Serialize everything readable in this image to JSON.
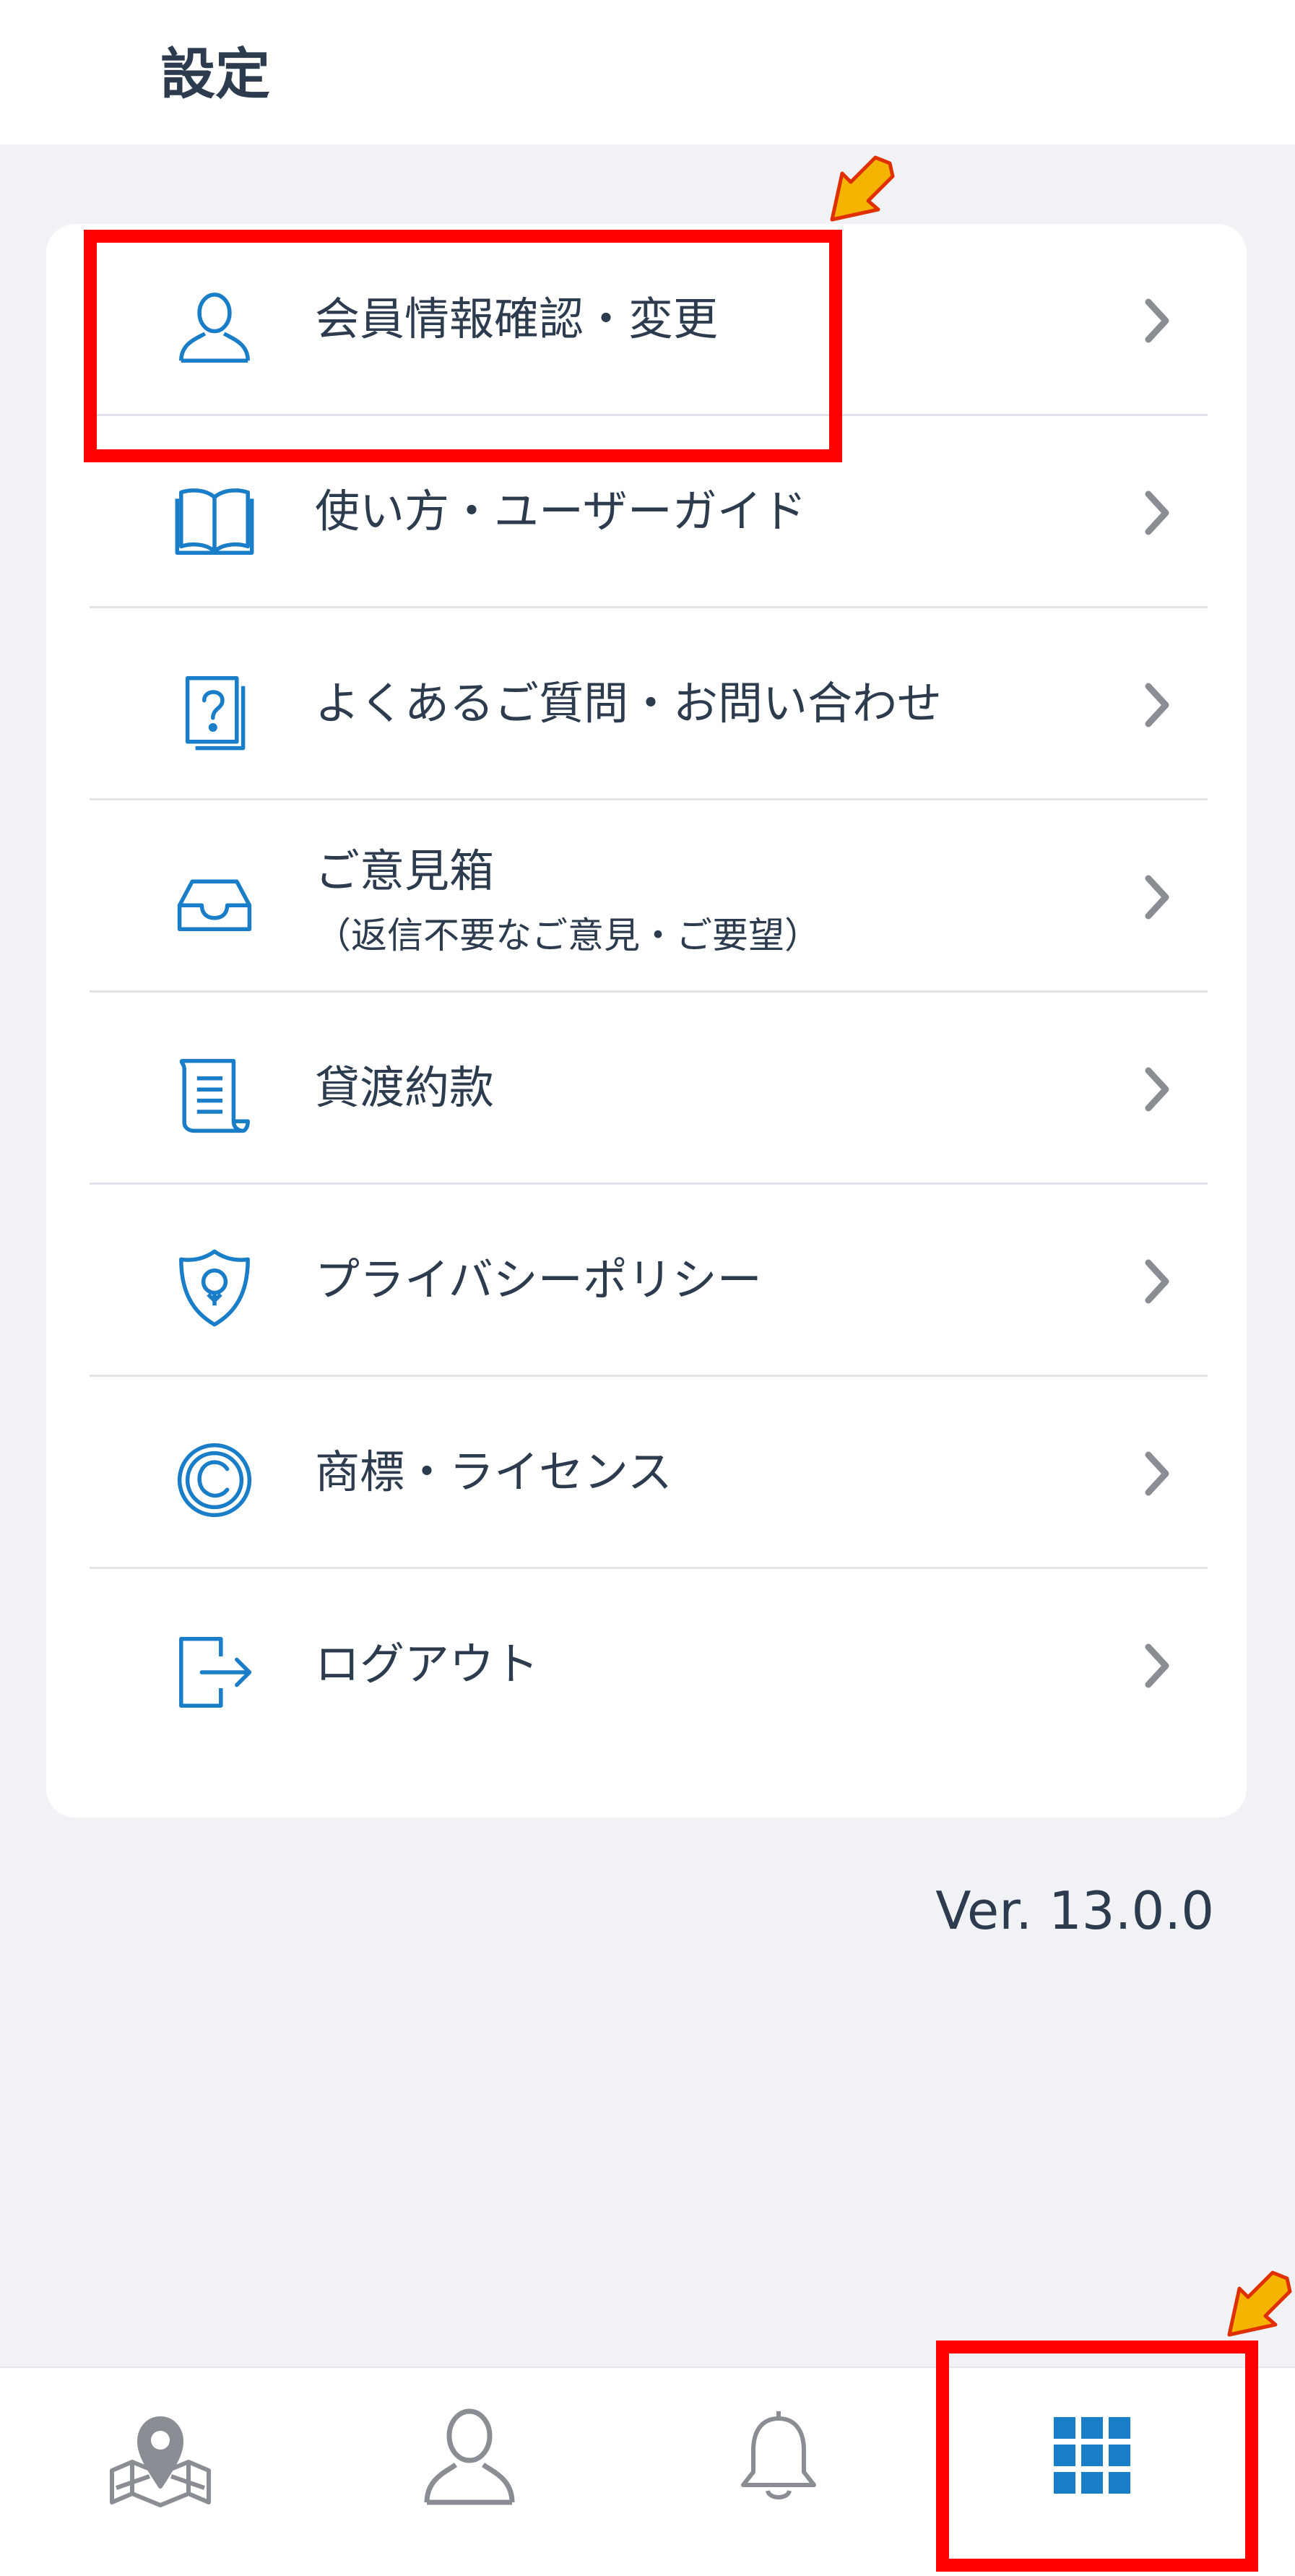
{
  "header": {
    "title": "設定"
  },
  "menu": {
    "items": [
      {
        "label": "会員情報確認・変更",
        "icon": "user-icon"
      },
      {
        "label": "使い方・ユーザーガイド",
        "icon": "book-icon"
      },
      {
        "label": "よくあるご質問・お問い合わせ",
        "icon": "faq-icon"
      },
      {
        "label": "ご意見箱",
        "sublabel": "（返信不要なご意見・ご要望）",
        "icon": "inbox-tray-icon"
      },
      {
        "label": "貸渡約款",
        "icon": "scroll-document-icon"
      },
      {
        "label": "プライバシーポリシー",
        "icon": "shield-icon"
      },
      {
        "label": "商標・ライセンス",
        "icon": "copyright-icon"
      },
      {
        "label": "ログアウト",
        "icon": "logout-icon"
      }
    ]
  },
  "version": "Ver. 13.0.0",
  "tabbar": {
    "tabs": [
      {
        "icon": "map-pin-icon"
      },
      {
        "icon": "user-icon"
      },
      {
        "icon": "bell-icon"
      },
      {
        "icon": "grid-menu-icon",
        "active": true
      }
    ]
  },
  "colors": {
    "accent": "#1a7dc8",
    "text": "#2c3b4d",
    "background": "#f1f2f6",
    "highlight": "#ff0000",
    "annotation_arrow": "#f5b400",
    "inactive_icon": "#8a8d94"
  }
}
